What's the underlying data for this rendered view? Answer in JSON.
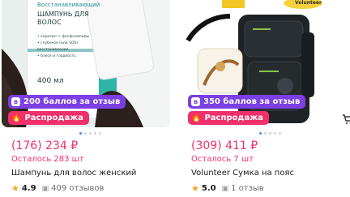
{
  "products": [
    {
      "image": {
        "brand_text": "Восстанавливающий",
        "product_text": "ШАМПУНЬ ДЛЯ ВОЛОС",
        "benefits": [
          "• кератин + фосфолипиды",
          "• глубокое (или SOS) восстановление",
          "• блеск и гладкость"
        ],
        "volume": "400 мл"
      },
      "points_badge": "200 баллов за отзыв",
      "sale_badge": "Распродажа",
      "price": "(176) 234 ₽",
      "stock": "Осталось 283 шт",
      "title": "Шампунь для волос женский",
      "rating": "4.9",
      "reviews": "409 отзывов"
    },
    {
      "image": {
        "top_label": "Volunteer"
      },
      "points_badge": "350 баллов за отзыв",
      "sale_badge": "Распродажа",
      "price": "(309) 411 ₽",
      "stock": "Осталось 7 шт",
      "title": "Volunteer Сумка на пояс",
      "rating": "5.0",
      "reviews": "1 отзыв"
    }
  ],
  "colors": {
    "accent_pink": "#f0306b",
    "points_purple": "#7b3fe4",
    "star": "#f5a623"
  },
  "icons": [
    "points-icon",
    "fire-icon",
    "star-icon",
    "review-icon",
    "cart-icon"
  ]
}
